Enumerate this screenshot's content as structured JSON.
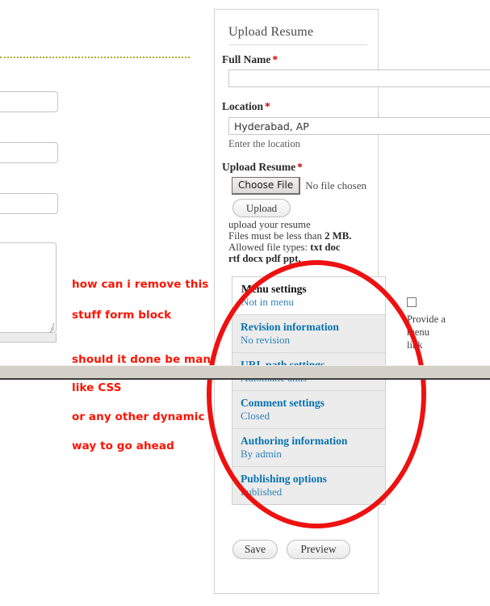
{
  "panel": {
    "title": "Upload Resume",
    "fields": {
      "full_name": {
        "label": "Full Name",
        "required_mark": "*",
        "value": "",
        "placeholder": ""
      },
      "location": {
        "label": "Location",
        "required_mark": "*",
        "value": "Hyderabad, AP",
        "placeholder": "",
        "help": "Enter the location"
      },
      "upload_resume": {
        "label": "Upload Resume",
        "required_mark": "*",
        "choose_file_label": "Choose File",
        "no_file_text": "No file chosen",
        "upload_button_label": "Upload",
        "desc_line_1": "upload your resume",
        "desc_line_2_prefix": "Files must be less than ",
        "desc_line_2_strong": "2 MB.",
        "desc_line_3_prefix": "Allowed file types: ",
        "desc_line_3_strong": "txt doc",
        "desc_line_4_strong": "rtf docx pdf ppt."
      }
    },
    "tabs": [
      {
        "title": "Menu settings",
        "summary": "Not in menu",
        "active": true
      },
      {
        "title": "Revision information",
        "summary": "No revision",
        "active": false
      },
      {
        "title": "URL path settings",
        "summary": "Automatic alias",
        "active": false
      },
      {
        "title": "Comment settings",
        "summary": "Closed",
        "active": false
      },
      {
        "title": "Authoring information",
        "summary": "By admin",
        "active": false
      },
      {
        "title": "Publishing options",
        "summary": "Published",
        "active": false
      }
    ],
    "menu_link": {
      "label": "Provide a menu link",
      "checked": false
    },
    "actions": {
      "save_label": "Save",
      "preview_label": "Preview"
    }
  },
  "annotations": {
    "color": "#ff1200",
    "lines": [
      "how can i remove this",
      "stuff form block",
      "should it done be manually",
      "like CSS",
      "or any other dynamic",
      "way to go ahead"
    ],
    "ellipse_color": "#ee1111"
  },
  "colors": {
    "tab_link_blue": "#0a72b0",
    "tab_summary_blue": "#2f82b8",
    "required_red": "#cc0000",
    "dotted_rule_olive": "#b5aa22",
    "scrollbar_gray": "#d4d0c8"
  }
}
